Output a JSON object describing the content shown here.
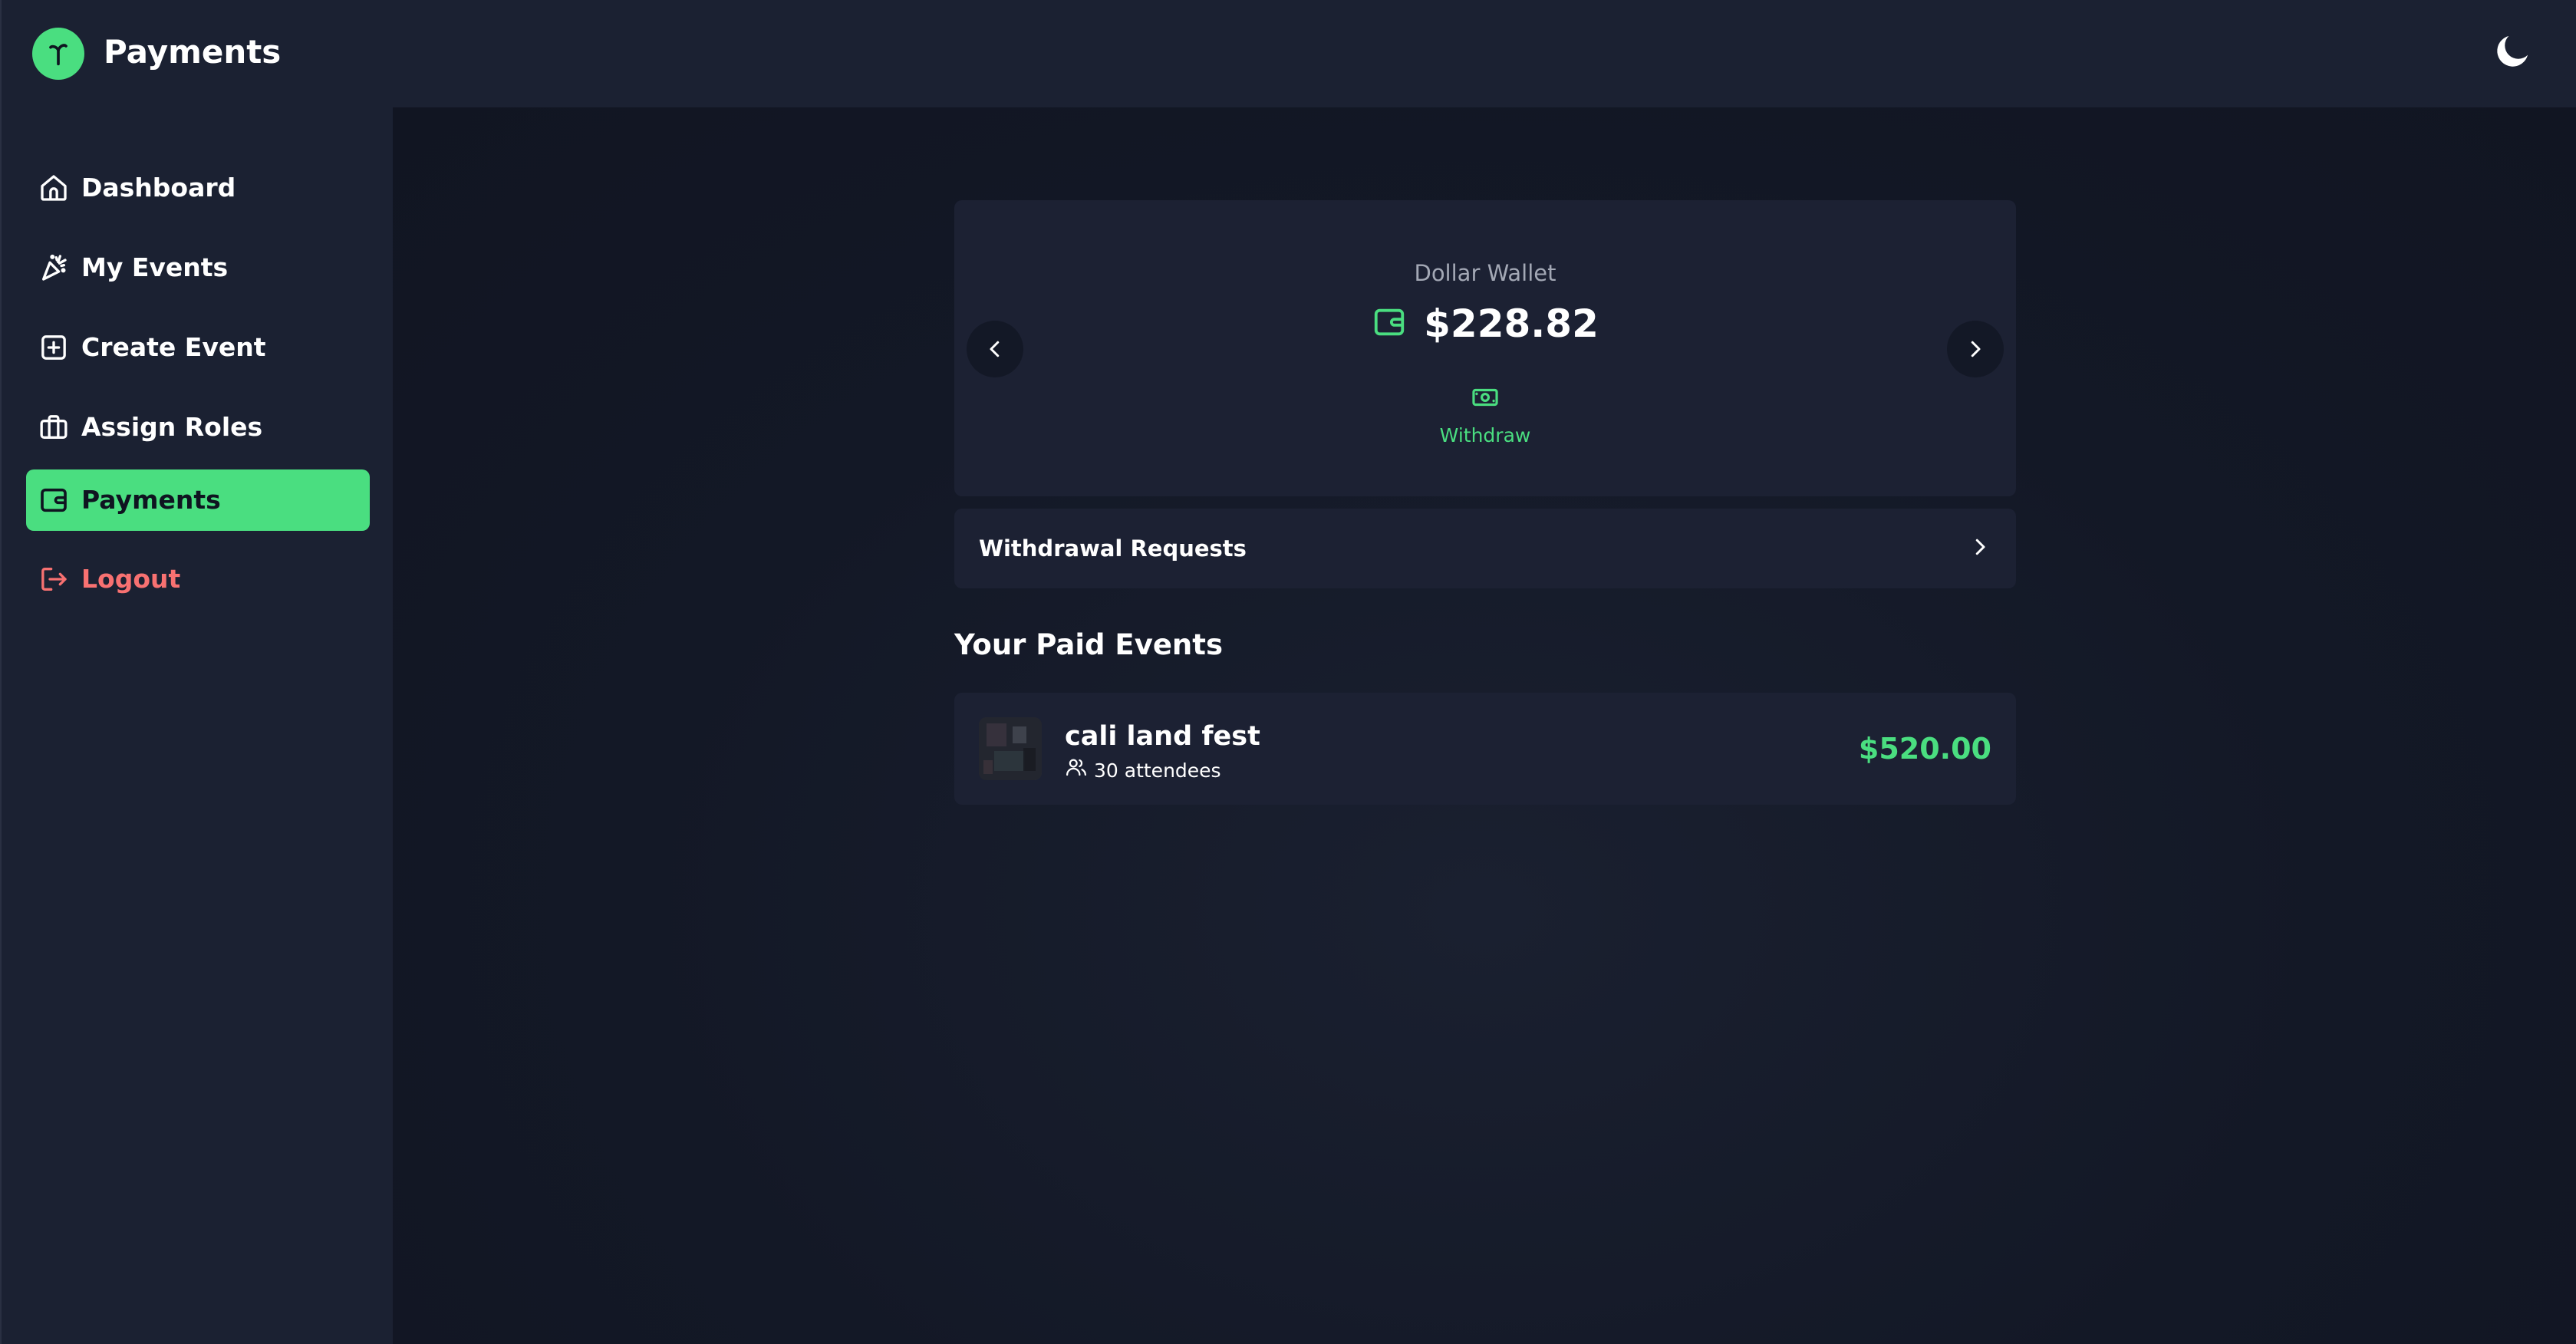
{
  "app": {
    "title": "Payments"
  },
  "colors": {
    "accent": "#4ade80",
    "danger": "#f87171",
    "panel": "#1c2133",
    "background": "#131826"
  },
  "sidebar": {
    "items": [
      {
        "label": "Dashboard",
        "icon": "home-icon"
      },
      {
        "label": "My Events",
        "icon": "party-popper-icon"
      },
      {
        "label": "Create Event",
        "icon": "plus-square-icon"
      },
      {
        "label": "Assign Roles",
        "icon": "briefcase-icon"
      },
      {
        "label": "Payments",
        "icon": "wallet-icon",
        "active": true
      },
      {
        "label": "Logout",
        "icon": "logout-icon"
      }
    ]
  },
  "wallet": {
    "title": "Dollar Wallet",
    "balance": "$228.82",
    "withdraw_label": "Withdraw"
  },
  "withdrawal_requests": {
    "label": "Withdrawal Requests"
  },
  "paid_events": {
    "heading": "Your Paid Events",
    "items": [
      {
        "name": "cali land fest",
        "attendees": "30 attendees",
        "amount": "$520.00"
      }
    ]
  }
}
